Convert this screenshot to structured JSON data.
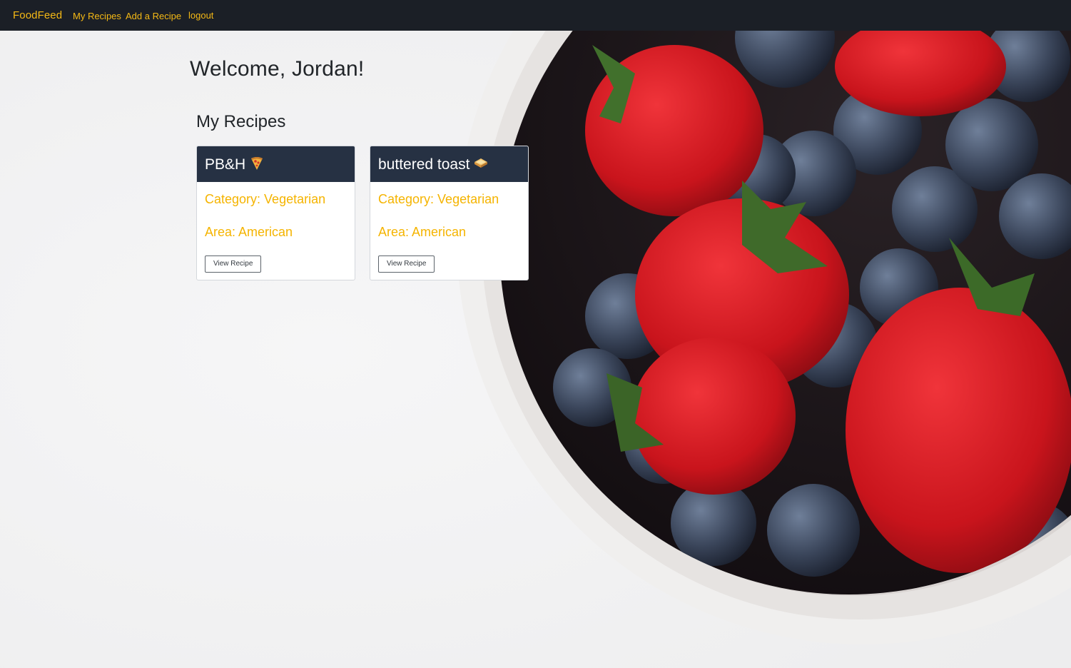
{
  "navbar": {
    "brand": "FoodFeed",
    "links": [
      "My Recipes",
      "Add a Recipe",
      "logout"
    ]
  },
  "page": {
    "welcome": "Welcome, Jordan!",
    "section_title": "My Recipes"
  },
  "recipes": [
    {
      "title": "PB&H",
      "emoji_icon": "pizza-icon",
      "category": "Category: Vegetarian",
      "area": "Area: American",
      "button": "View Recipe"
    },
    {
      "title": "buttered toast",
      "emoji_icon": "sandwich-icon",
      "category": "Category: Vegetarian",
      "area": "Area: American",
      "button": "View Recipe"
    }
  ],
  "colors": {
    "navbar_bg": "#1b1f26",
    "accent": "#f5b915",
    "card_header_bg": "#263143",
    "page_bg": "#f3f3f4"
  }
}
